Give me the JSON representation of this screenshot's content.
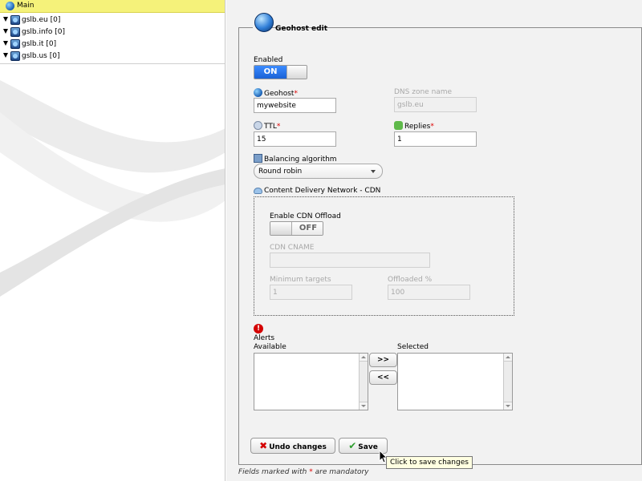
{
  "tree": {
    "root_label": "Main",
    "items": [
      {
        "label": "gslb.eu [0]"
      },
      {
        "label": "gslb.info [0]"
      },
      {
        "label": "gslb.it [0]"
      },
      {
        "label": "gslb.us [0]"
      }
    ]
  },
  "form": {
    "title": "Geohost edit",
    "enabled": {
      "label": "Enabled",
      "state": "ON"
    },
    "geohost": {
      "label": "Geohost",
      "required_mark": "*",
      "value": "mywebsite"
    },
    "dns_zone": {
      "label": "DNS zone name",
      "value": "gslb.eu"
    },
    "ttl": {
      "label": "TTL",
      "required_mark": "*",
      "value": "15"
    },
    "replies": {
      "label": "Replies",
      "required_mark": "*",
      "value": "1"
    },
    "balancing": {
      "label": "Balancing algorithm",
      "selected": "Round robin"
    },
    "cdn": {
      "label": "Content Delivery Network - CDN",
      "offload_label": "Enable CDN Offload",
      "offload_state": "OFF",
      "cname_label": "CDN CNAME",
      "cname_value": "",
      "min_targets_label": "Minimum targets",
      "min_targets_value": "1",
      "offloaded_label": "Offloaded %",
      "offloaded_value": "100"
    },
    "alerts": {
      "label": "Alerts",
      "available_label": "Available",
      "selected_label": "Selected",
      "add_label": ">>",
      "remove_label": "<<"
    },
    "undo_label": "Undo changes",
    "save_label": "Save",
    "tooltip": "Click to save changes",
    "footer": {
      "prefix": "Fields marked with ",
      "mark": "*",
      "suffix": " are mandatory"
    }
  },
  "colors": {
    "tree_root_bg": "#f5f27a",
    "toggle_on": "#1a62d6",
    "required": "#dd0000",
    "alert_red": "#d40000"
  }
}
